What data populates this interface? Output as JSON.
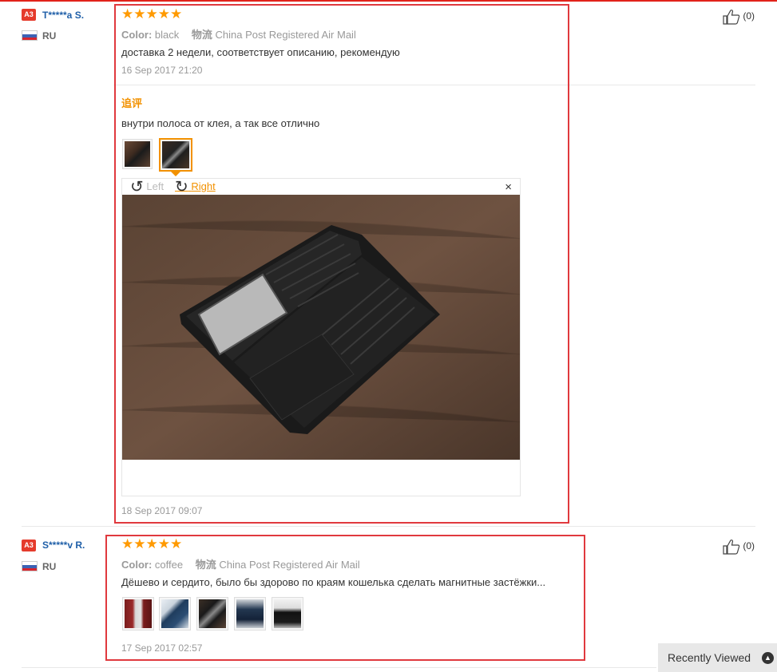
{
  "reviews": [
    {
      "badge": "A3",
      "user": "T*****a S.",
      "country": "RU",
      "stars": "★★★★★",
      "color_label": "Color:",
      "color_value": "black",
      "shipping_label": "物流",
      "shipping_value": "China Post Registered Air Mail",
      "text": "доставка 2 недели, соответствует описанию, рекомендую",
      "date": "16 Sep 2017 21:20",
      "likes": "(0)",
      "additional": {
        "label": "追评",
        "text": "внутри полоса от клея, а так все отлично",
        "date": "18 Sep 2017 09:07"
      }
    },
    {
      "badge": "A3",
      "user": "S*****v R.",
      "country": "RU",
      "stars": "★★★★★",
      "color_label": "Color:",
      "color_value": "coffee",
      "shipping_label": "物流",
      "shipping_value": "China Post Registered Air Mail",
      "text": "Дёшево и сердито, было бы здорово по краям кошелька сделать магнитные застёжки...",
      "date": "17 Sep 2017 02:57",
      "likes": "(0)"
    }
  ],
  "viewer": {
    "rotate_left": "Left",
    "rotate_right": "Right",
    "close": "×"
  },
  "recently_viewed": "Recently Viewed",
  "colors": {
    "accent": "#f29100",
    "highlight": "#e0393e",
    "star": "#ff9a00",
    "link": "#1f5fa8"
  }
}
